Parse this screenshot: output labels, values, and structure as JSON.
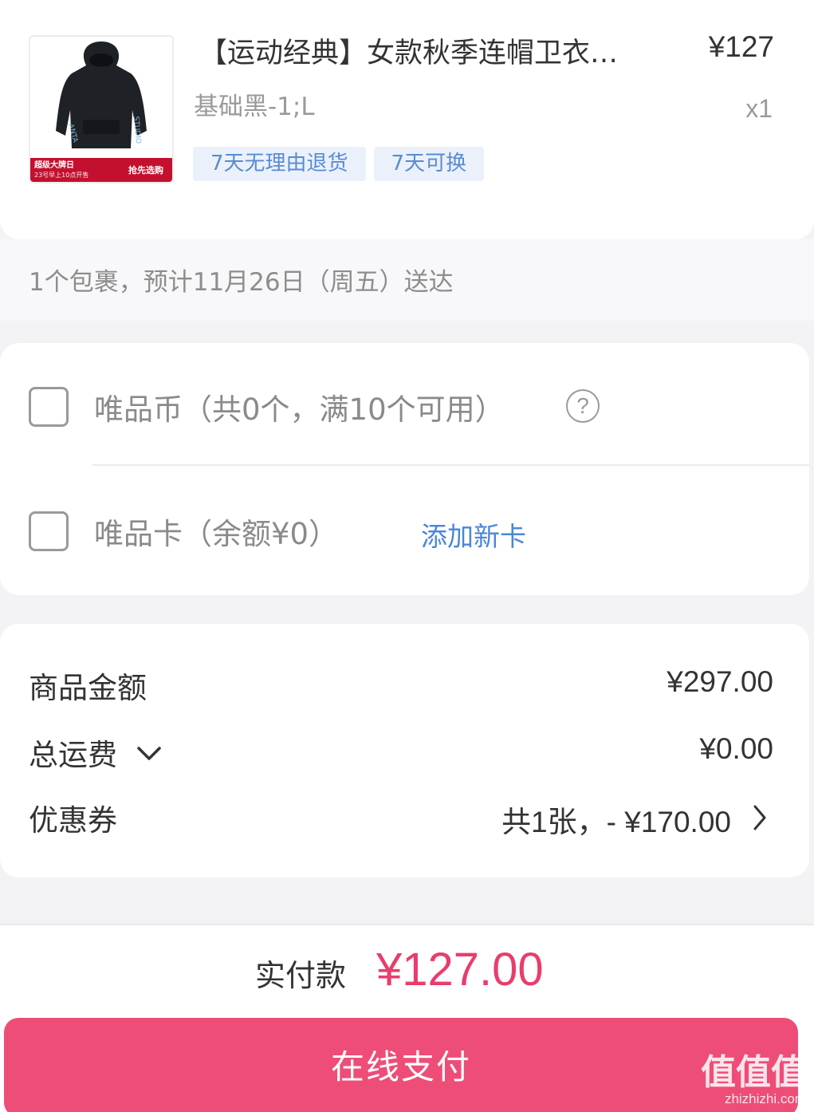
{
  "product": {
    "promo_brand": "超级大牌日",
    "promo_time": "23号早上10点开售",
    "promo_cta": "抢先选购",
    "title": "【运动经典】女款秋季连帽卫衣…",
    "price": "¥127",
    "spec": "基础黑-1;L",
    "quantity": "x1",
    "tags": [
      "7天无理由退货",
      "7天可换"
    ]
  },
  "delivery": {
    "text": "1个包裹，预计11月26日（周五）送达"
  },
  "options": {
    "coins_label": "唯品币（共0个，满10个可用）",
    "coins_help_icon": "?",
    "card_label": "唯品卡（余额¥0）",
    "add_card_label": "添加新卡"
  },
  "summary": {
    "goods_amount_label": "商品金额",
    "goods_amount_value": "¥297.00",
    "shipping_label": "总运费",
    "shipping_value": "¥0.00",
    "coupon_label": "优惠券",
    "coupon_value": "共1张，- ¥170.00"
  },
  "footer": {
    "pay_label": "实付款",
    "pay_amount": "¥127.00",
    "pay_button": "在线支付",
    "watermark_main": "值值值",
    "watermark_url": "zhizhizhi.com"
  },
  "colors": {
    "accent_pink": "#ee4d77",
    "amount_pink": "#e93d6b",
    "link_blue": "#4a86d9",
    "tag_bg": "#eaf1fb"
  }
}
